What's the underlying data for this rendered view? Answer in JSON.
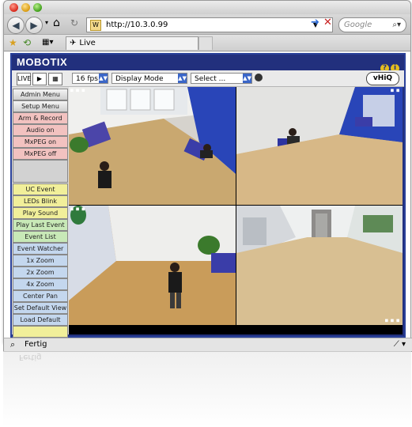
{
  "browser": {
    "url": "http://10.3.0.99",
    "search_placeholder": "Google",
    "tab_title": "Live",
    "status_text": "Fertig"
  },
  "camera": {
    "brand": "MOBOTIX",
    "toolbar": {
      "fps": "16 fps",
      "mode": "Display Mode",
      "select": "Select ...",
      "vhiq": "vHiQ"
    },
    "sidebar": [
      {
        "label": "Admin Menu",
        "style": "gray"
      },
      {
        "label": "Setup Menu",
        "style": "gray"
      },
      {
        "label": "Arm & Record",
        "style": "pink"
      },
      {
        "label": "Audio on",
        "style": "pink"
      },
      {
        "label": "MxPEG on",
        "style": "pink"
      },
      {
        "label": "MxPEG off",
        "style": "pink"
      },
      {
        "label": "",
        "style": "empty"
      },
      {
        "label": "UC Event",
        "style": "yellow"
      },
      {
        "label": "LEDs Blink",
        "style": "yellow"
      },
      {
        "label": "Play Sound",
        "style": "yellow"
      },
      {
        "label": "Play Last Event",
        "style": "green"
      },
      {
        "label": "Event List",
        "style": "green"
      },
      {
        "label": "Event Watcher",
        "style": "blue"
      },
      {
        "label": "1x Zoom",
        "style": "blue"
      },
      {
        "label": "2x Zoom",
        "style": "blue"
      },
      {
        "label": "4x Zoom",
        "style": "blue"
      },
      {
        "label": "Center Pan",
        "style": "blue"
      },
      {
        "label": "Set Default View",
        "style": "blue"
      },
      {
        "label": "Load Default View",
        "style": "blue"
      },
      {
        "label": "",
        "style": "yellow"
      }
    ]
  },
  "colors": {
    "frame_blue": "#22307d",
    "logo_yellow": "#e4bd1f"
  }
}
